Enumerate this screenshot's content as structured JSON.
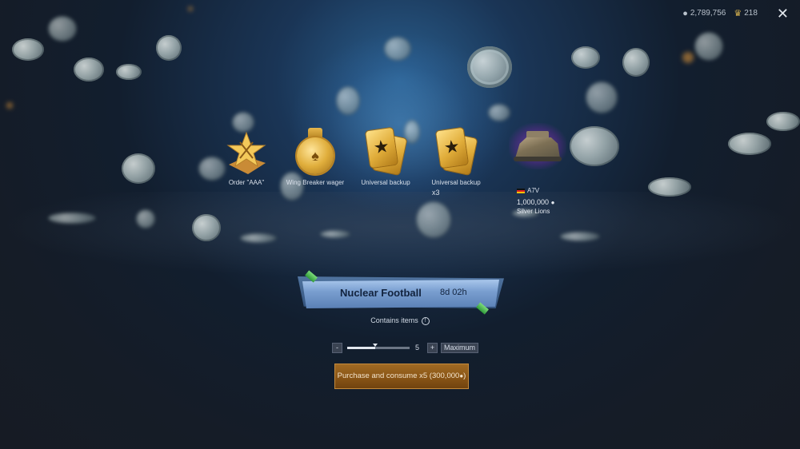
{
  "currency": {
    "silver_lions": "2,789,756",
    "golden_eagles": "218",
    "silver_icon": "silver-lion-icon",
    "gold_icon": "golden-eagle-icon"
  },
  "items": [
    {
      "label": "Order \"AAA\"",
      "icon": "order-star-icon"
    },
    {
      "label": "Wing Breaker wager",
      "icon": "lion-medal-icon"
    },
    {
      "label": "Universal backup",
      "icon": "backup-card-icon"
    },
    {
      "label": "Universal backup",
      "icon": "backup-card-icon",
      "quantity": "x3"
    }
  ],
  "vehicle": {
    "name": "A7V",
    "price": "1,000,000",
    "currency_label": "Silver Lions",
    "flag_color": "#d22222"
  },
  "banner": {
    "title": "Nuclear Football",
    "timer": "8d 02h",
    "ribbon_color": "#4dbb4a"
  },
  "contains_text": "Contains items",
  "quantity": {
    "minus": "-",
    "plus": "+",
    "value": "5",
    "fraction": 0.45,
    "max_label": "Maximum"
  },
  "purchase_button": "Purchase and consume x5 (300,000",
  "accent_color": "#8a5516"
}
